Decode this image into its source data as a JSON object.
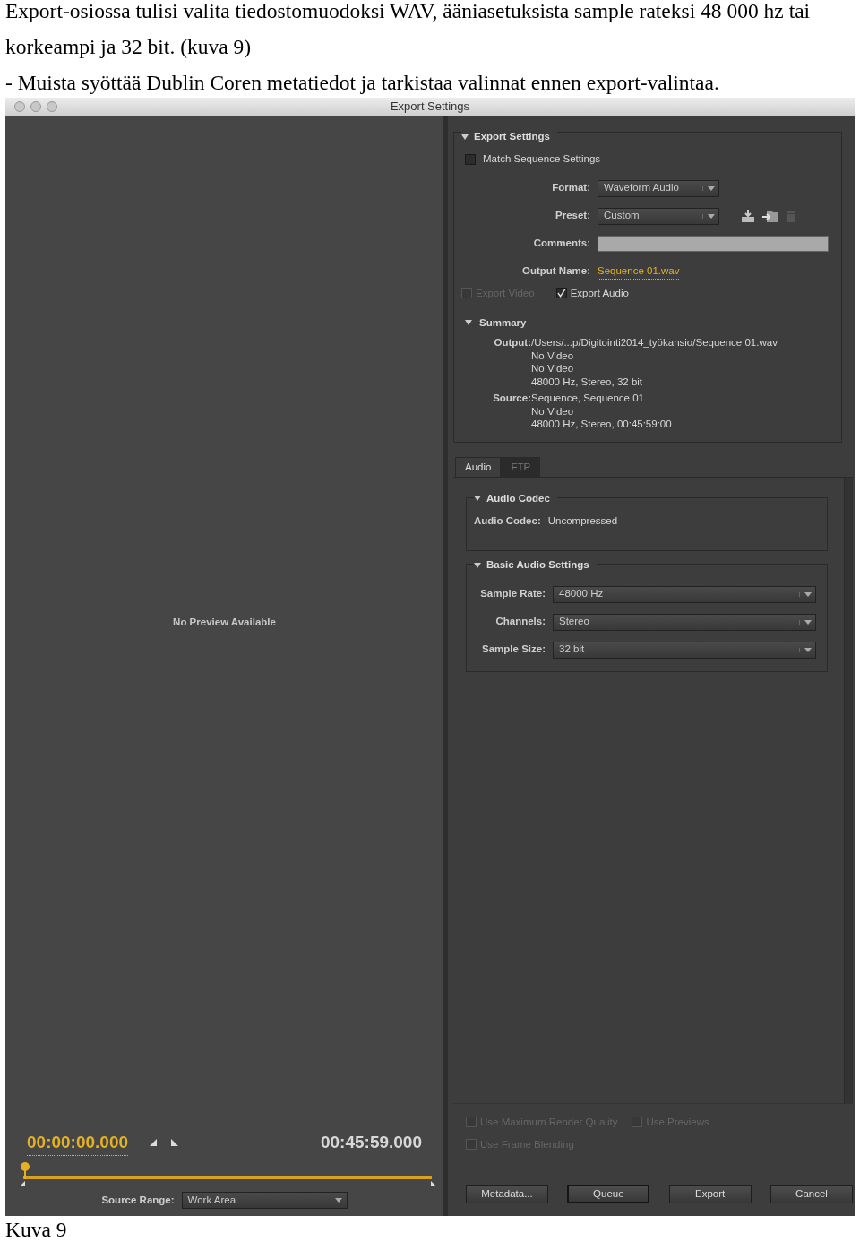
{
  "document": {
    "paragraphs": [
      "Export-osiossa tulisi valita tiedostomuodoksi WAV, ääniasetuksista sample rateksi 48 000 hz tai korkeampi ja 32 bit. (kuva 9)",
      "-  Muista syöttää Dublin Coren metatiedot ja tarkistaa valinnat ennen export-valintaa."
    ],
    "caption": "Kuva 9"
  },
  "window": {
    "title": "Export Settings"
  },
  "preview": {
    "message": "No Preview Available",
    "start_time": "00:00:00.000",
    "end_time": "00:45:59.000",
    "source_range": {
      "label": "Source Range:",
      "value": "Work Area"
    }
  },
  "export_settings": {
    "title": "Export Settings",
    "expanded": true,
    "match_sequence": {
      "label": "Match Sequence Settings",
      "checked": false
    },
    "fields": [
      {
        "kind": "dropdown",
        "label": "Format:",
        "value": "Waveform Audio"
      },
      {
        "kind": "preset",
        "label": "Preset:",
        "value": "Custom"
      },
      {
        "kind": "text",
        "label": "Comments:"
      },
      {
        "kind": "link",
        "label": "Output Name:",
        "value": "Sequence 01.wav"
      }
    ],
    "exports": [
      {
        "label": "Export Video",
        "checked": false,
        "disabled": true
      },
      {
        "label": "Export Audio",
        "checked": true,
        "disabled": false
      }
    ],
    "summary": {
      "title": "Summary",
      "expanded": true,
      "groups": [
        {
          "label": "Output:",
          "lines": [
            "/Users/...p/Digitointi2014_työkansio/Sequence 01.wav",
            "No Video",
            "No Video",
            "48000 Hz, Stereo, 32 bit"
          ]
        },
        {
          "label": "Source:",
          "lines": [
            "Sequence, Sequence 01",
            "No Video",
            "48000 Hz, Stereo, 00:45:59:00"
          ]
        }
      ]
    }
  },
  "tabs": [
    {
      "label": "Audio",
      "selected": true
    },
    {
      "label": "FTP",
      "selected": false
    }
  ],
  "audio_codec": {
    "title": "Audio Codec",
    "expanded": true,
    "label": "Audio Codec:",
    "value": "Uncompressed"
  },
  "basic_audio": {
    "title": "Basic Audio Settings",
    "expanded": true,
    "fields": [
      {
        "label": "Sample Rate:",
        "value": "48000 Hz"
      },
      {
        "label": "Channels:",
        "value": "Stereo"
      },
      {
        "label": "Sample Size:",
        "value": "32 bit"
      }
    ]
  },
  "options": [
    [
      {
        "label": "Use Maximum Render Quality",
        "checked": false,
        "disabled": true
      },
      {
        "label": "Use Previews",
        "checked": false,
        "disabled": true
      }
    ],
    [
      {
        "label": "Use Frame Blending",
        "checked": false,
        "disabled": true
      }
    ]
  ],
  "buttons": [
    {
      "label": "Metadata...",
      "focused": false
    },
    {
      "label": "Queue",
      "focused": true
    },
    {
      "label": "Export",
      "focused": false
    },
    {
      "label": "Cancel",
      "focused": false
    }
  ]
}
